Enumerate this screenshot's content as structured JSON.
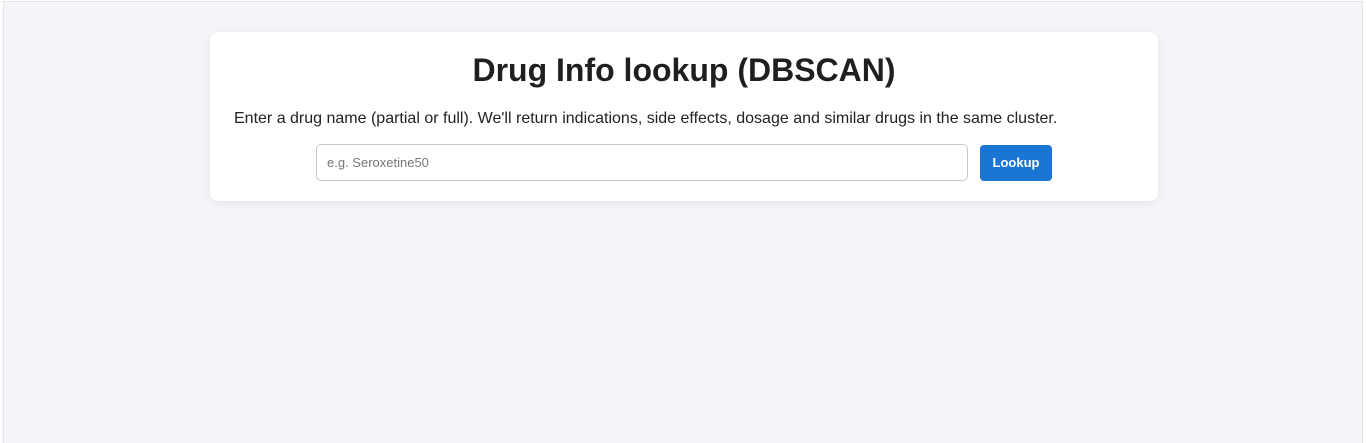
{
  "header": {
    "title": "Drug Info lookup (DBSCAN)",
    "description": "Enter a drug name (partial or full). We'll return indications, side effects, dosage and similar drugs in the same cluster."
  },
  "search": {
    "placeholder": "e.g. Seroxetine50",
    "value": "",
    "button_label": "Lookup"
  },
  "colors": {
    "page_background": "#f4f5f9",
    "card_background": "#ffffff",
    "accent": "#1a76d2"
  }
}
